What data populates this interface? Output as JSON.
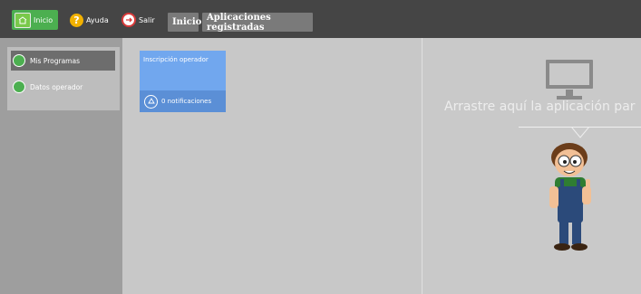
{
  "topbar": {
    "inicio_label": "Inicio",
    "ayuda_label": "Ayuda",
    "salir_label": "Salir",
    "breadcrumb": [
      "Inicio",
      "Aplicaciones registradas"
    ]
  },
  "sidebar": {
    "items": [
      {
        "label": "Mis Programas",
        "icon": "window-icon"
      },
      {
        "label": "Datos operador",
        "icon": "user-icon"
      }
    ]
  },
  "tiles": [
    {
      "title": "Inscripción operador",
      "notifications": "0 notificaciones",
      "icon": "bell-icon"
    }
  ],
  "dropzone": {
    "text": "Arrastre aquí la aplicación par"
  },
  "colors": {
    "topbar_bg": "#454545",
    "inicio_green": "#4caf50",
    "tile_blue": "#71a7ee",
    "tile_blue_dark": "#5b8fd6",
    "sidebar_bg": "#9e9e9e"
  }
}
